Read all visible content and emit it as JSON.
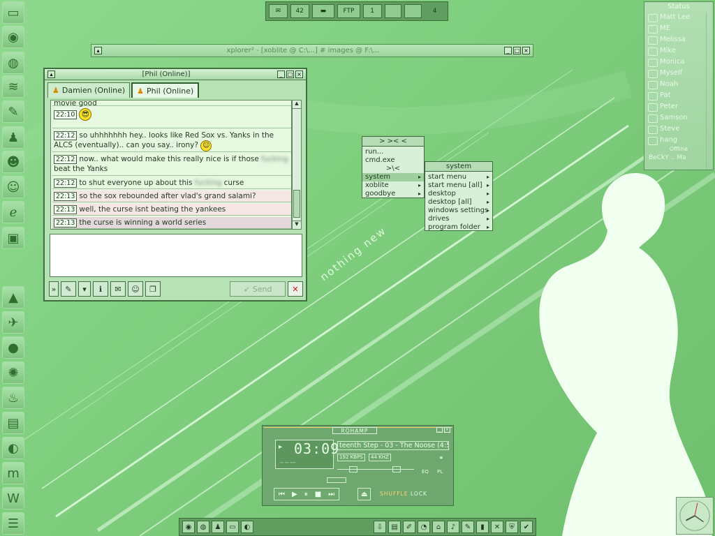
{
  "topbar": {
    "mail_count": "42",
    "ftp_label": "FTP",
    "desk_first": "1",
    "desk_count": "4"
  },
  "explorer": {
    "title": "xplorer² - [xoblite @ C:\\...] # images @ F:\\..."
  },
  "chat": {
    "window_title": "[Phil  (Online)]",
    "tabs": [
      {
        "label": "Damien  (Online)"
      },
      {
        "label": "Phil  (Online)"
      }
    ],
    "messages": [
      {
        "time": "",
        "text": "movie good"
      },
      {
        "time": "22:10",
        "text": ""
      },
      {
        "time": "22:12",
        "text": "so uhhhhhhh hey.. looks like Red Sox vs. Yanks in the ALCS (eventually).. can you say.. irony?"
      },
      {
        "time": "22:12",
        "text_a": "now.. what would make this really nice is if those",
        "blurred": "fucking",
        "text_b": "beat the Yanks"
      },
      {
        "time": "22:12",
        "text_a": "to shut everyone up about this",
        "blurred": "fucking",
        "text_b": "curse"
      },
      {
        "time": "22:13",
        "text": "so the sox rebounded after vlad's grand salami?"
      },
      {
        "time": "22:13",
        "text": "well, the curse isnt beating the yankees"
      },
      {
        "time": "22:13",
        "text": "the curse is winning a world series"
      }
    ],
    "send_label": "Send"
  },
  "menu_main": {
    "header": "> >< <",
    "items": [
      "run...",
      "cmd.exe",
      ">\\<",
      "system",
      "xoblite",
      "goodbye"
    ]
  },
  "menu_system": {
    "header": "system",
    "items": [
      "start menu",
      "start menu [all]",
      "desktop",
      "desktop [all]",
      "windows settings",
      "drives",
      "program folder"
    ]
  },
  "buddy": {
    "header": "Status",
    "names": [
      "Matt Lee",
      "ME",
      "Melissa",
      "Mike",
      "Monica",
      "Myself",
      "Noah",
      "Pat",
      "Peter",
      "Samson",
      "Steve",
      "hang"
    ],
    "offline_label": "Offline",
    "footer": "BeCkY :. Ma"
  },
  "watermark": "nothing new",
  "player": {
    "title": "ROHAMP",
    "time": "03:09",
    "sub": "-- -- ---",
    "song": "teenth Step - 03 - The Noose (4:5",
    "kbps": "192 KBPS",
    "khz": "44 KHZ",
    "eq": "EQ",
    "pl": "PL",
    "shuffle": "SHUFFLE",
    "lock": "LOCK"
  },
  "colors": {
    "desktop": "#7fcf7f",
    "accent": "#3f713f",
    "close": "#cc1111"
  }
}
